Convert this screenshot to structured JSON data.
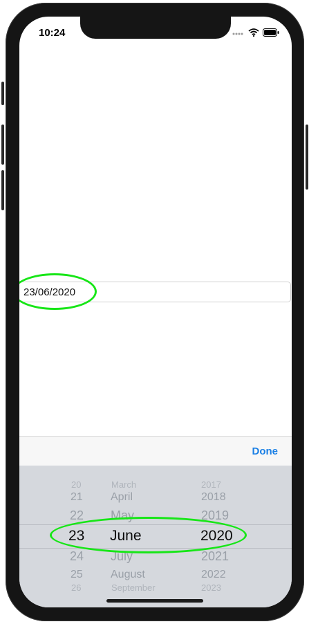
{
  "status_bar": {
    "time": "10:24"
  },
  "date_field": {
    "value": "23/06/2020"
  },
  "toolbar": {
    "done_label": "Done"
  },
  "picker": {
    "days": [
      "20",
      "21",
      "22",
      "23",
      "24",
      "25",
      "26"
    ],
    "months": [
      "March",
      "April",
      "May",
      "June",
      "July",
      "August",
      "September"
    ],
    "years": [
      "2017",
      "2018",
      "2019",
      "2020",
      "2021",
      "2022",
      "2023"
    ],
    "selected": {
      "day": "23",
      "month": "June",
      "year": "2020"
    }
  },
  "colors": {
    "accent": "#1a7fe5",
    "highlight": "#17e617",
    "picker_bg": "#d5d8dd"
  }
}
